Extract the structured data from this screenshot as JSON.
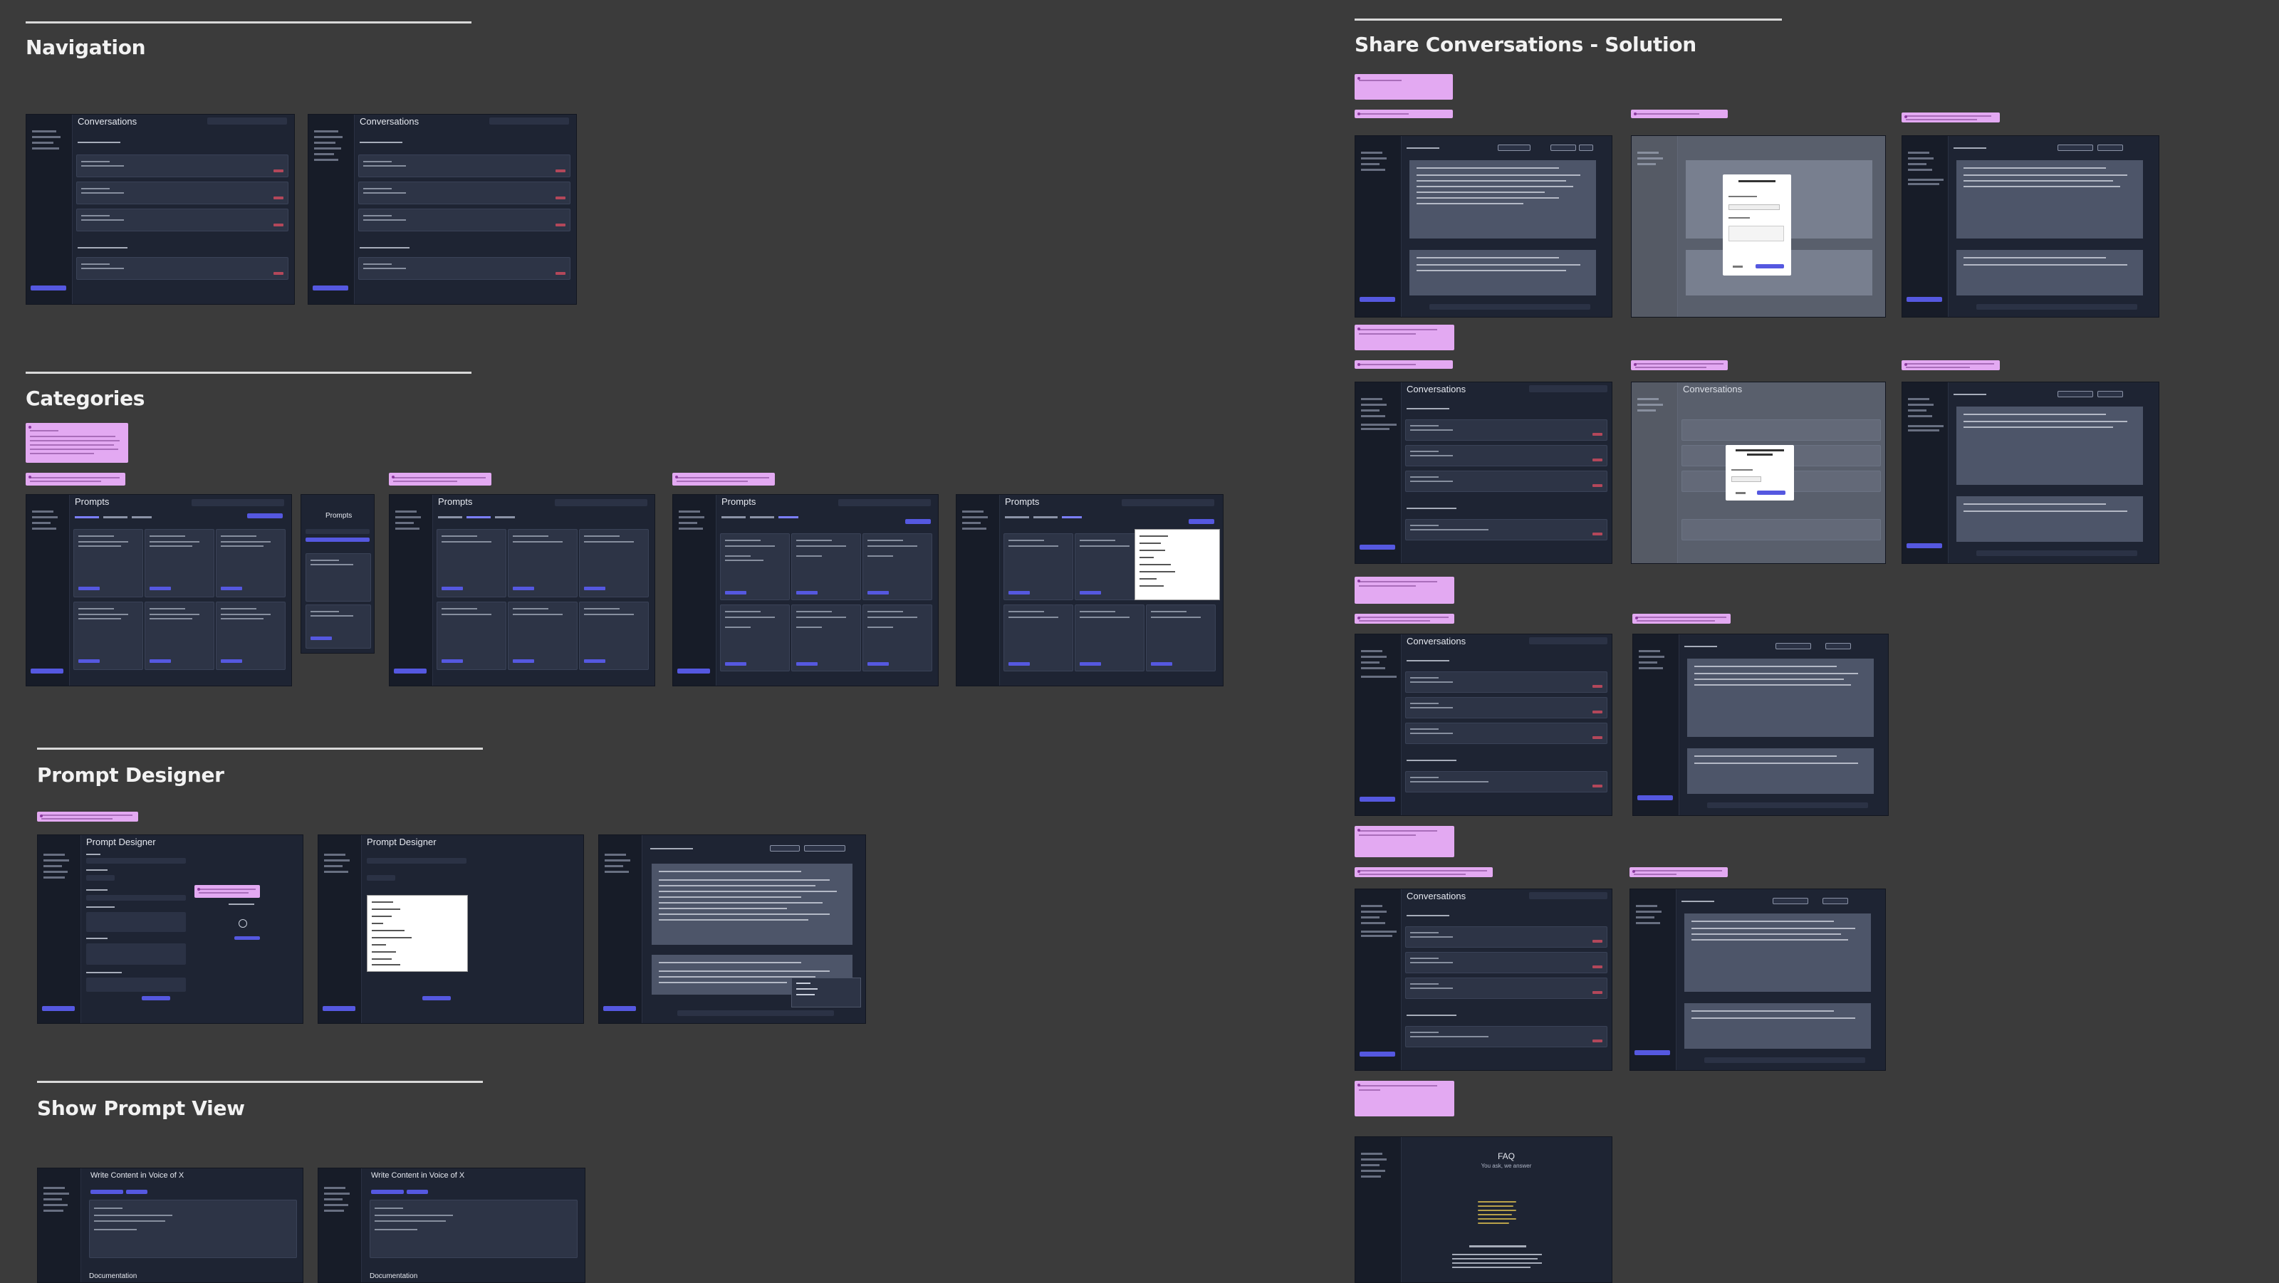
{
  "sections": {
    "navigation": {
      "title": "Navigation"
    },
    "categories": {
      "title": "Categories"
    },
    "prompt_designer": {
      "title": "Prompt Designer"
    },
    "show_prompt_view": {
      "title": "Show Prompt View"
    },
    "share_conversations": {
      "title": "Share Conversations - Solution"
    }
  },
  "frames": {
    "conversations_title": "Conversations",
    "prompts_title": "Prompts",
    "prompt_designer_title": "Prompt Designer",
    "write_content_title": "Write Content in Voice of X",
    "documentation_label": "Documentation",
    "faq_title": "FAQ",
    "faq_subtitle": "You ask, we answer"
  },
  "colors": {
    "canvas": "#3b3b3b",
    "frame_bg": "#1e2433",
    "sidebar_bg": "#171c28",
    "card_bg": "#2d3446",
    "accent": "#5558e0",
    "danger": "#b3475a",
    "note": "#e3a9f2"
  }
}
